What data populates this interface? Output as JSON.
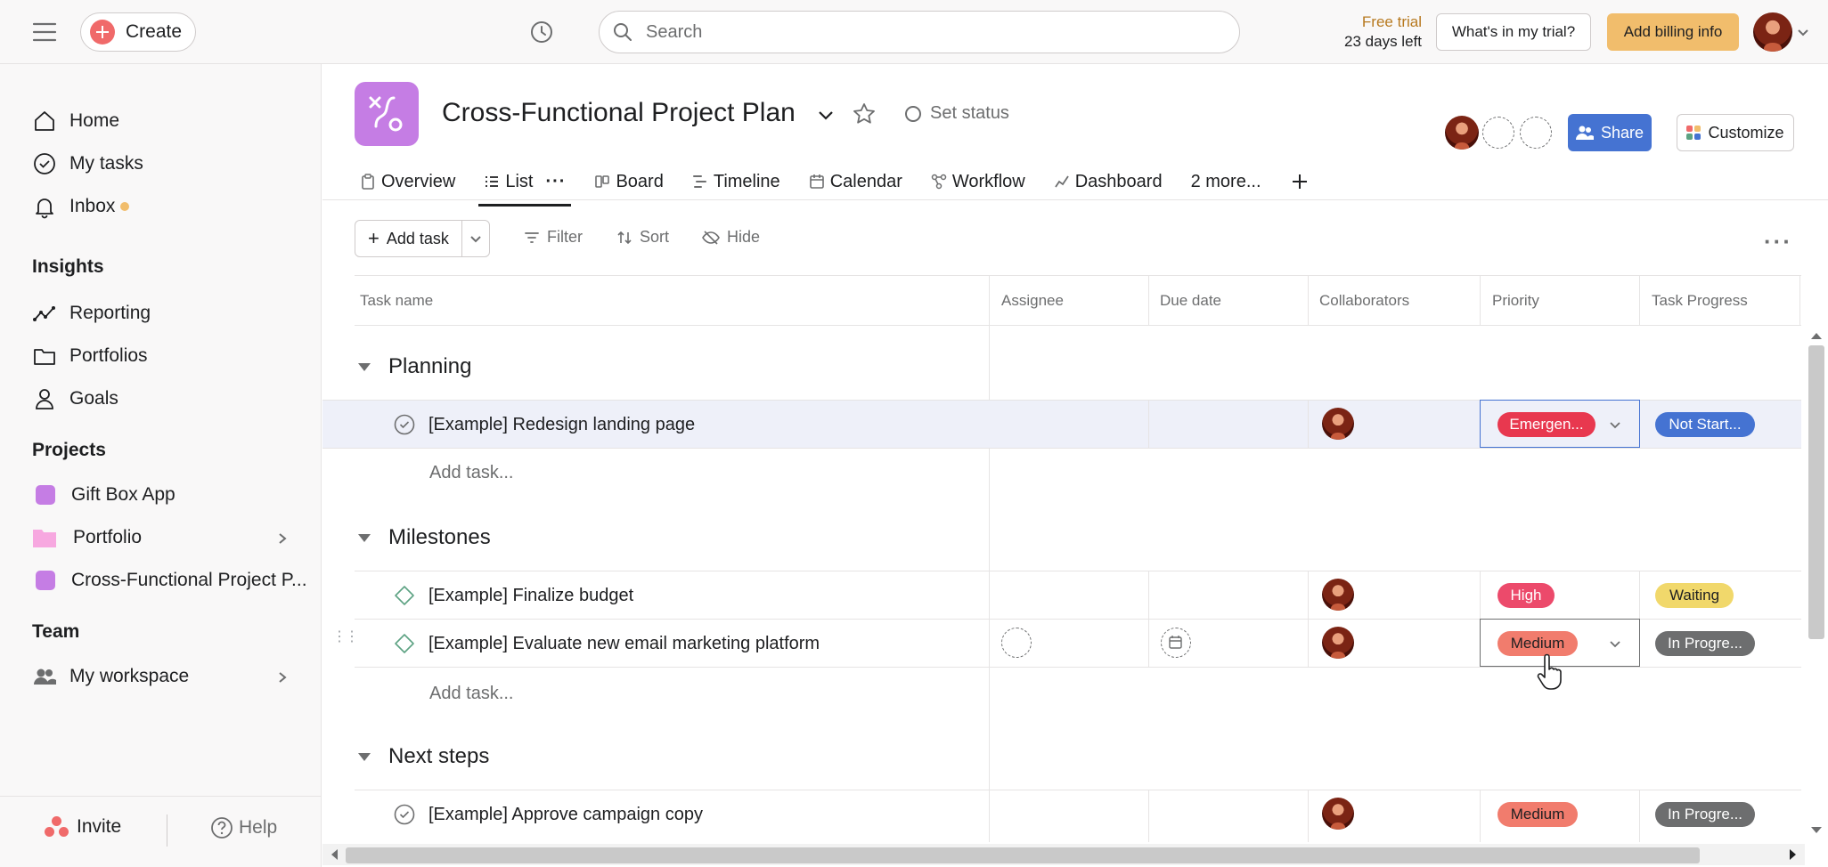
{
  "topbar": {
    "create_label": "Create",
    "search_placeholder": "Search",
    "trial_line1": "Free trial",
    "trial_line2": "23 days left",
    "whats_in_trial": "What's in my trial?",
    "add_billing": "Add billing info"
  },
  "sidebar": {
    "home": "Home",
    "my_tasks": "My tasks",
    "inbox": "Inbox",
    "insights_heading": "Insights",
    "reporting": "Reporting",
    "portfolios": "Portfolios",
    "goals": "Goals",
    "projects_heading": "Projects",
    "projects": [
      {
        "label": "Gift Box App",
        "color": "#c57de4"
      },
      {
        "label": "Portfolio",
        "color": "#f7a8e0"
      },
      {
        "label": "Cross-Functional Project P...",
        "color": "#c57de4"
      }
    ],
    "team_heading": "Team",
    "my_workspace": "My workspace",
    "invite": "Invite",
    "help": "Help"
  },
  "project": {
    "title": "Cross-Functional Project Plan",
    "set_status": "Set status",
    "share": "Share",
    "customize": "Customize"
  },
  "tabs": [
    "Overview",
    "List",
    "Board",
    "Timeline",
    "Calendar",
    "Workflow",
    "Dashboard",
    "2 more..."
  ],
  "toolbar": {
    "add_task": "Add task",
    "filter": "Filter",
    "sort": "Sort",
    "hide": "Hide"
  },
  "columns": [
    "Task name",
    "Assignee",
    "Due date",
    "Collaborators",
    "Priority",
    "Task Progress"
  ],
  "groups": [
    {
      "name": "Planning",
      "tasks": [
        {
          "name": "[Example] Redesign landing page",
          "priority": "Emergen...",
          "progress": "Not Start..."
        }
      ],
      "add_task": "Add task..."
    },
    {
      "name": "Milestones",
      "tasks": [
        {
          "name": "[Example] Finalize budget",
          "priority": "High",
          "progress": "Waiting"
        },
        {
          "name": "[Example] Evaluate new email marketing platform",
          "priority": "Medium",
          "progress": "In Progre..."
        }
      ],
      "add_task": "Add task..."
    },
    {
      "name": "Next steps",
      "tasks": [
        {
          "name": "[Example] Approve campaign copy",
          "priority": "Medium",
          "progress": "In Progre..."
        }
      ]
    }
  ],
  "colors": {
    "emergency": "#e8384f",
    "high": "#ec4a6b",
    "medium": "#f17c6d",
    "not_started": "#4573d2",
    "waiting": "#f1d86b",
    "in_progress": "#6d6e6f",
    "share": "#4573d2",
    "billing": "#f1bd6c"
  }
}
